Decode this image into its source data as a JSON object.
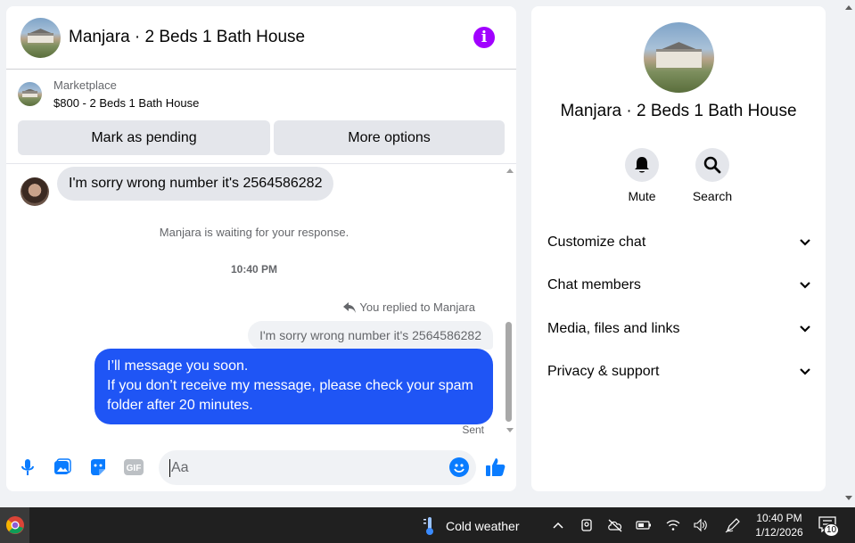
{
  "chat": {
    "title": "Manjara · 2 Beds 1 Bath House",
    "marketplace": {
      "label": "Marketplace",
      "listing": "$800 - 2 Beds 1 Bath House",
      "mark_pending_label": "Mark as pending",
      "more_options_label": "More options"
    },
    "messages": {
      "incoming": "I'm sorry wrong number it's 2564586282",
      "waiting_note": "Manjara is waiting for your response.",
      "timestamp": "10:40 PM",
      "reply_note": "You replied to Manjara",
      "quoted": "I'm sorry wrong number it's 2564586282",
      "outgoing_line1": "I’ll message you soon.",
      "outgoing_line2": "If you don’t receive my message, please check your spam folder after 20 minutes.",
      "status": "Sent"
    },
    "composer": {
      "placeholder": "Aa"
    }
  },
  "info_panel": {
    "name": "Manjara · 2 Beds 1 Bath House",
    "actions": [
      {
        "label": "Mute",
        "icon": "bell-icon"
      },
      {
        "label": "Search",
        "icon": "search-icon"
      }
    ],
    "sections": [
      {
        "label": "Customize chat"
      },
      {
        "label": "Chat members"
      },
      {
        "label": "Media, files and links"
      },
      {
        "label": "Privacy & support"
      }
    ]
  },
  "taskbar": {
    "weather": "Cold weather",
    "time": "10:40 PM",
    "date": "1/12/2026",
    "notification_count": "10"
  },
  "colors": {
    "accent_blue": "#1f55f5",
    "messenger_blue": "#0a7cff",
    "info_purple": "#a100ff"
  }
}
